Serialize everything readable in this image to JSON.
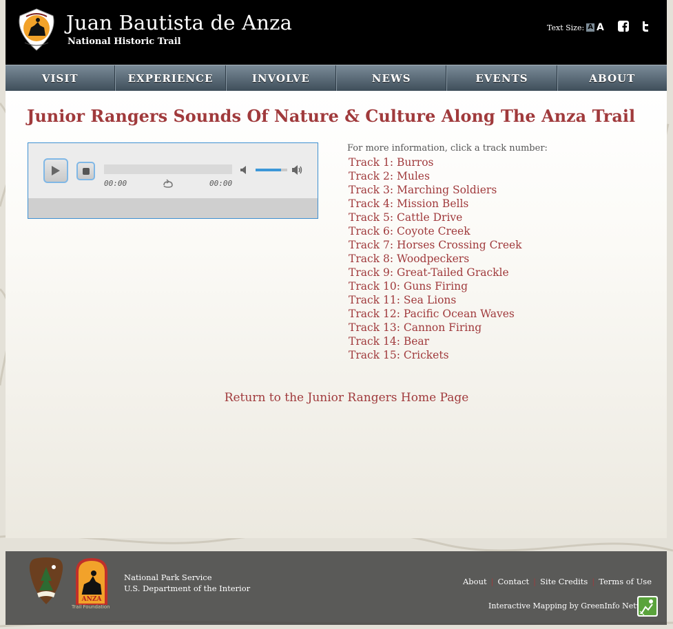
{
  "header": {
    "title": "Juan Bautista de Anza",
    "subtitle": "National Historic Trail",
    "logo_text": "JUAN BAUTISTA DE ANZA",
    "text_size_label": "Text Size:",
    "text_size_small": "A",
    "text_size_large": "A",
    "social": [
      "facebook-icon",
      "twitter-icon"
    ]
  },
  "nav": {
    "items": [
      "VISIT",
      "EXPERIENCE",
      "INVOLVE",
      "NEWS",
      "EVENTS",
      "ABOUT"
    ]
  },
  "main": {
    "title": "Junior Rangers Sounds Of Nature & Culture Along The Anza Trail",
    "player": {
      "current_time": "00:00",
      "duration": "00:00",
      "volume": 0.8
    },
    "tracks_intro": "For more information, click a track number:",
    "tracks": [
      "Track 1: Burros",
      "Track 2: Mules",
      "Track 3: Marching Soldiers",
      "Track 4: Mission Bells",
      "Track 5: Cattle Drive",
      "Track 6: Coyote Creek",
      "Track 7: Horses Crossing Creek",
      "Track 8: Woodpeckers",
      "Track 9: Great-Tailed Grackle",
      "Track 10: Guns Firing",
      "Track 11: Sea Lions",
      "Track 12: Pacific Ocean Waves",
      "Track 13: Cannon Firing",
      "Track 14: Bear",
      "Track 15: Crickets"
    ],
    "return_link": "Return to the Junior Rangers Home Page"
  },
  "footer": {
    "agency_line1": "National Park Service",
    "agency_line2": "U.S. Department of the Interior",
    "anza_caption": "Trail Foundation",
    "links": [
      "About",
      "Contact",
      "Site Credits",
      "Terms of Use"
    ],
    "credit": "Interactive Mapping by GreenInfo Network"
  },
  "colors": {
    "accent": "#a03a3c",
    "header_bg": "#000000",
    "nav_top": "#7a8b98",
    "nav_bottom": "#3f4e5a",
    "player_border": "#3d8fd1"
  }
}
